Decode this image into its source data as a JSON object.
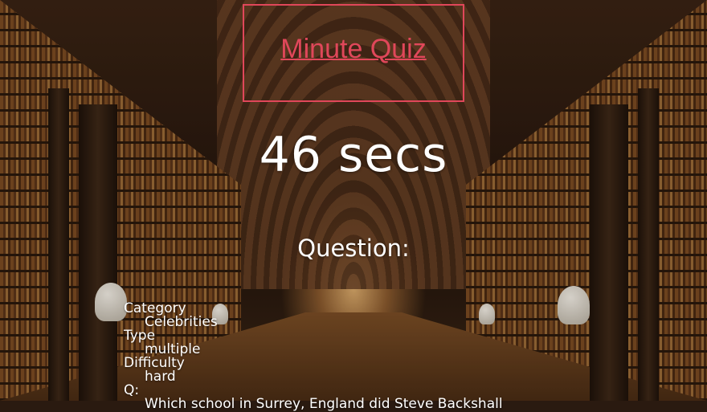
{
  "header": {
    "title": "Minute Quiz",
    "title_color": "#e0475a"
  },
  "timer": {
    "text": "46 secs"
  },
  "question": {
    "heading": "Question:",
    "category_label": "Category",
    "category_value": "Celebrities",
    "type_label": "Type",
    "type_value": "multiple",
    "difficulty_label": "Difficulty",
    "difficulty_value": "hard",
    "q_label": "Q:",
    "q_text": "Which school in Surrey, England did Steve Backshall"
  }
}
